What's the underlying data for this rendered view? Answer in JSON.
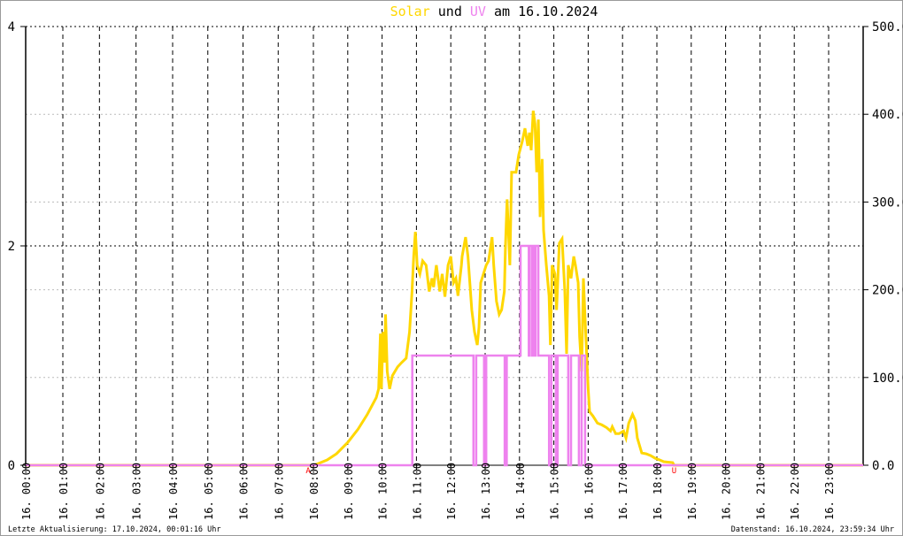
{
  "chart_data": {
    "type": "line",
    "title_parts": [
      {
        "text": "Solar",
        "color": "#ffd700"
      },
      {
        "text": " und ",
        "color": "#000000"
      },
      {
        "text": "UV",
        "color": "#ee82ee"
      },
      {
        "text": " am 16.10.2024",
        "color": "#000000"
      }
    ],
    "x_unit": "hour of day",
    "xlim": [
      0,
      24
    ],
    "x_tick_labels": [
      "16. 00:00",
      "16. 01:00",
      "16. 02:00",
      "16. 03:00",
      "16. 04:00",
      "16. 05:00",
      "16. 06:00",
      "16. 07:00",
      "16. 08:00",
      "16. 09:00",
      "16. 10:00",
      "16. 11:00",
      "16. 12:00",
      "16. 13:00",
      "16. 14:00",
      "16. 15:00",
      "16. 16:00",
      "16. 17:00",
      "16. 18:00",
      "16. 19:00",
      "16. 20:00",
      "16. 21:00",
      "16. 22:00",
      "16. 23:00"
    ],
    "y_left": {
      "label": "UV",
      "ylim": [
        0,
        4
      ],
      "tick_labels": [
        "0",
        "2",
        "4"
      ],
      "ticks": [
        0,
        2,
        4
      ]
    },
    "y_right": {
      "label": "Solar",
      "ylim": [
        0,
        500
      ],
      "tick_labels": [
        "0.0",
        "100.0",
        "200.0",
        "300.0",
        "400.0",
        "500.0"
      ],
      "ticks": [
        0,
        100,
        200,
        300,
        400,
        500
      ]
    },
    "grid": true,
    "markers": [
      {
        "label": "A",
        "x": 7.85,
        "color": "#ff0000"
      },
      {
        "label": "U",
        "x": 18.5,
        "color": "#ff0000"
      }
    ],
    "series": [
      {
        "name": "Solar",
        "axis": "right",
        "color": "#ffd700",
        "points": [
          [
            0,
            0
          ],
          [
            8.0,
            0
          ],
          [
            8.15,
            2
          ],
          [
            8.4,
            6
          ],
          [
            8.67,
            13
          ],
          [
            9.0,
            26
          ],
          [
            9.3,
            41
          ],
          [
            9.57,
            58
          ],
          [
            9.83,
            77
          ],
          [
            9.9,
            87
          ],
          [
            9.95,
            150
          ],
          [
            9.98,
            87
          ],
          [
            10.03,
            152
          ],
          [
            10.08,
            117
          ],
          [
            10.1,
            172
          ],
          [
            10.15,
            107
          ],
          [
            10.22,
            87
          ],
          [
            10.3,
            102
          ],
          [
            10.45,
            112
          ],
          [
            10.57,
            117
          ],
          [
            10.7,
            122
          ],
          [
            10.8,
            152
          ],
          [
            10.87,
            198
          ],
          [
            10.92,
            238
          ],
          [
            10.97,
            266
          ],
          [
            11.02,
            228
          ],
          [
            11.1,
            218
          ],
          [
            11.18,
            233
          ],
          [
            11.28,
            228
          ],
          [
            11.37,
            198
          ],
          [
            11.45,
            213
          ],
          [
            11.5,
            203
          ],
          [
            11.58,
            228
          ],
          [
            11.68,
            198
          ],
          [
            11.75,
            218
          ],
          [
            11.83,
            192
          ],
          [
            11.92,
            228
          ],
          [
            12.0,
            238
          ],
          [
            12.08,
            208
          ],
          [
            12.15,
            213
          ],
          [
            12.21,
            193
          ],
          [
            12.31,
            228
          ],
          [
            12.33,
            238
          ],
          [
            12.43,
            260
          ],
          [
            12.5,
            238
          ],
          [
            12.61,
            177
          ],
          [
            12.69,
            152
          ],
          [
            12.77,
            137
          ],
          [
            12.82,
            157
          ],
          [
            12.87,
            208
          ],
          [
            12.95,
            218
          ],
          [
            13.03,
            228
          ],
          [
            13.1,
            233
          ],
          [
            13.2,
            260
          ],
          [
            13.25,
            228
          ],
          [
            13.33,
            187
          ],
          [
            13.41,
            172
          ],
          [
            13.48,
            177
          ],
          [
            13.56,
            198
          ],
          [
            13.59,
            248
          ],
          [
            13.64,
            303
          ],
          [
            13.72,
            228
          ],
          [
            13.77,
            334
          ],
          [
            13.9,
            334
          ],
          [
            13.98,
            354
          ],
          [
            14.08,
            369
          ],
          [
            14.16,
            384
          ],
          [
            14.24,
            364
          ],
          [
            14.29,
            379
          ],
          [
            14.34,
            359
          ],
          [
            14.4,
            404
          ],
          [
            14.45,
            389
          ],
          [
            14.5,
            334
          ],
          [
            14.55,
            394
          ],
          [
            14.6,
            283
          ],
          [
            14.66,
            349
          ],
          [
            14.7,
            268
          ],
          [
            14.78,
            228
          ],
          [
            14.86,
            193
          ],
          [
            14.9,
            137
          ],
          [
            14.95,
            228
          ],
          [
            15.03,
            218
          ],
          [
            15.08,
            177
          ],
          [
            15.16,
            253
          ],
          [
            15.24,
            258
          ],
          [
            15.32,
            198
          ],
          [
            15.37,
            127
          ],
          [
            15.42,
            228
          ],
          [
            15.5,
            213
          ],
          [
            15.58,
            238
          ],
          [
            15.63,
            228
          ],
          [
            15.71,
            208
          ],
          [
            15.75,
            147
          ],
          [
            15.81,
            107
          ],
          [
            15.86,
            213
          ],
          [
            15.91,
            167
          ],
          [
            16.0,
            87
          ],
          [
            16.04,
            61
          ],
          [
            16.14,
            56
          ],
          [
            16.27,
            48
          ],
          [
            16.4,
            46
          ],
          [
            16.53,
            43
          ],
          [
            16.65,
            39
          ],
          [
            16.7,
            44
          ],
          [
            16.8,
            36
          ],
          [
            16.9,
            36
          ],
          [
            17.03,
            39
          ],
          [
            17.1,
            31
          ],
          [
            17.18,
            48
          ],
          [
            17.29,
            58
          ],
          [
            17.37,
            51
          ],
          [
            17.43,
            31
          ],
          [
            17.56,
            14
          ],
          [
            17.69,
            13
          ],
          [
            17.82,
            11
          ],
          [
            17.95,
            8
          ],
          [
            18.08,
            6
          ],
          [
            18.2,
            4
          ],
          [
            18.46,
            3
          ],
          [
            18.5,
            0
          ],
          [
            24,
            0
          ]
        ]
      },
      {
        "name": "UV",
        "axis": "left",
        "color": "#ee82ee",
        "step": true,
        "points": [
          [
            0,
            0
          ],
          [
            10.88,
            0
          ],
          [
            10.88,
            1
          ],
          [
            12.66,
            1
          ],
          [
            12.66,
            0
          ],
          [
            12.74,
            0
          ],
          [
            12.74,
            1
          ],
          [
            12.97,
            1
          ],
          [
            12.97,
            0
          ],
          [
            13.03,
            0
          ],
          [
            13.03,
            1
          ],
          [
            13.57,
            1
          ],
          [
            13.57,
            0
          ],
          [
            13.63,
            0
          ],
          [
            13.63,
            1
          ],
          [
            14.03,
            1
          ],
          [
            14.03,
            2
          ],
          [
            14.27,
            2
          ],
          [
            14.27,
            1
          ],
          [
            14.3,
            1
          ],
          [
            14.3,
            2
          ],
          [
            14.37,
            2
          ],
          [
            14.37,
            1
          ],
          [
            14.4,
            1
          ],
          [
            14.4,
            2
          ],
          [
            14.44,
            2
          ],
          [
            14.44,
            1
          ],
          [
            14.47,
            1
          ],
          [
            14.47,
            2
          ],
          [
            14.55,
            2
          ],
          [
            14.55,
            1
          ],
          [
            14.86,
            1
          ],
          [
            14.86,
            0
          ],
          [
            14.93,
            0
          ],
          [
            14.93,
            1
          ],
          [
            15.06,
            1
          ],
          [
            15.06,
            0
          ],
          [
            15.11,
            0
          ],
          [
            15.11,
            1
          ],
          [
            15.42,
            1
          ],
          [
            15.42,
            0
          ],
          [
            15.5,
            0
          ],
          [
            15.5,
            1
          ],
          [
            15.73,
            1
          ],
          [
            15.73,
            0
          ],
          [
            15.81,
            0
          ],
          [
            15.81,
            1
          ],
          [
            15.91,
            1
          ],
          [
            15.91,
            0
          ],
          [
            24,
            0
          ]
        ]
      }
    ]
  },
  "footer": {
    "last_update": "Letzte Aktualisierung: 17.10.2024, 00:01:16 Uhr",
    "data_state": "Datenstand: 16.10.2024, 23:59:34 Uhr"
  }
}
